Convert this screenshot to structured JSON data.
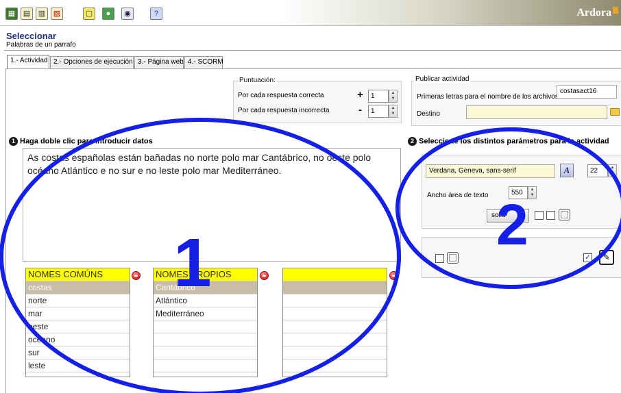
{
  "app": {
    "brand": "Ardora"
  },
  "toolbar": {
    "buttons": [
      "new-activity",
      "open-file",
      "save-file",
      "save-as",
      "info",
      "globe",
      "eye-preview",
      "help"
    ]
  },
  "header": {
    "title": "Seleccionar",
    "subtitle": "Palabras de un parrafo"
  },
  "tabs": [
    {
      "label": "1.- Actividad",
      "active": true
    },
    {
      "label": "2.- Opciones de ejecución",
      "active": false
    },
    {
      "label": "3.- Página web",
      "active": false
    },
    {
      "label": "4.- SCORM",
      "active": false
    }
  ],
  "scoring": {
    "group_label": "Puntuación:",
    "correct_label": "Por cada respuesta correcta",
    "correct_sign": "+",
    "correct_value": "1",
    "incorrect_label": "Por cada respuesta incorrecta",
    "incorrect_sign": "-",
    "incorrect_value": "1"
  },
  "publish": {
    "group_label": "Publicar actividad",
    "prefix_label": "Primeras letras para el nombre de los archivos",
    "prefix_value": "costasact16",
    "dest_label": "Destino",
    "dest_value": ""
  },
  "section1": {
    "number": "1",
    "title": "Haga doble clic para introducir datos"
  },
  "section2": {
    "number": "2",
    "title": "Seleccione los distintos parámetros para la actividad"
  },
  "text_content": "As costas españolas están bañadas no norte polo mar Cantábrico, no oeste polo océano Atlántico e no sur e no leste polo mar Mediterráneo.",
  "lists": [
    {
      "header": "NOMES COMÚNS",
      "items": [
        "costas",
        "norte",
        "mar",
        "oeste",
        "océano",
        "sur",
        "leste",
        "",
        ""
      ],
      "selected": 0
    },
    {
      "header": "NOMES PROPIOS",
      "items": [
        "Cantábrico",
        "Atlántico",
        "Mediterráneo",
        "",
        "",
        "",
        "",
        "",
        ""
      ],
      "selected": 0
    },
    {
      "header": "",
      "items": [
        "",
        "",
        "",
        "",
        "",
        "",
        "",
        "",
        ""
      ],
      "selected": 0
    }
  ],
  "params": {
    "font_value": "Verdana, Geneva, sans-serif",
    "font_size": "22",
    "width_label": "Ancho área de texto",
    "width_value": "550",
    "border_style": "solid"
  },
  "annotations": {
    "one": "1",
    "two": "2",
    "color": "#1420e6"
  }
}
